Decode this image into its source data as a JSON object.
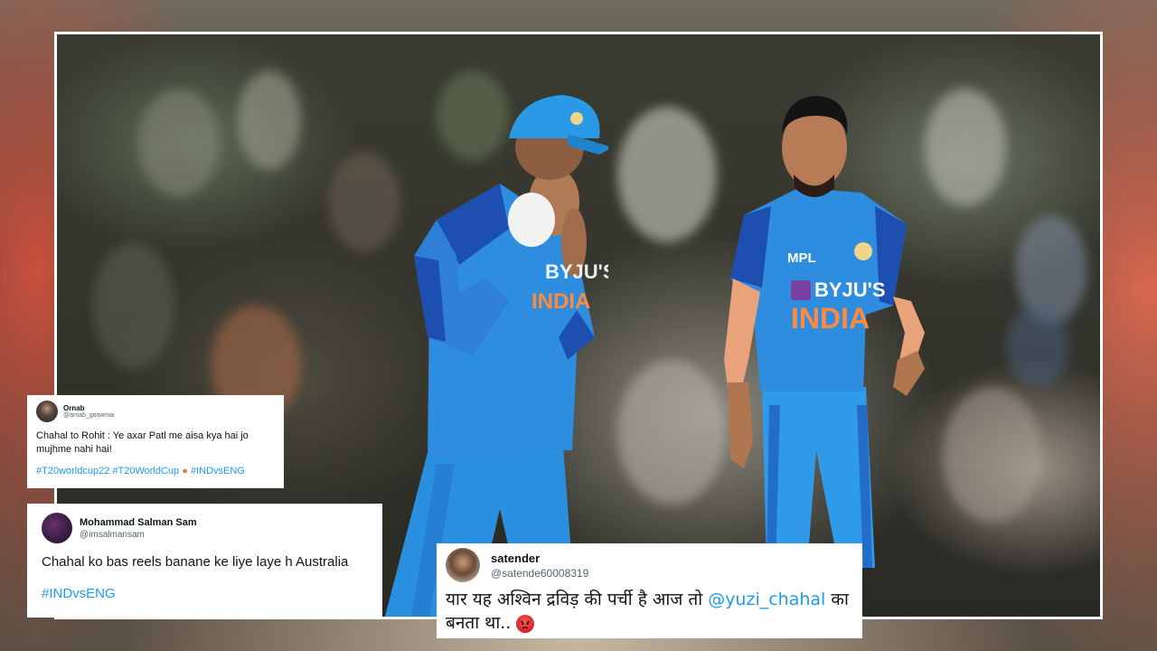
{
  "tweets": [
    {
      "name": "Ornab",
      "handle": "@arnab_goswmai",
      "text": "Chahal to Rohit : Ye axar Patl me aisa kya hai jo mujhme nahi hai!",
      "hashtags": "#T20worldcup22 #T20WorldCup",
      "hashtags_after_emoji": "#INDvsENG"
    },
    {
      "name": "Mohammad Salman Sam",
      "handle": "@imsalmansam",
      "text": "Chahal ko bas reels banane ke liye laye h Australia",
      "hashtags": "#INDvsENG"
    },
    {
      "name": "satender",
      "handle": "@satende60008319",
      "text_before_mention": "यार यह अश्विन द्रविड़ की पर्ची है आज तो ",
      "mention": "@yuzi_chahal",
      "text_after_mention": " का बनता था..",
      "emoji": "angry-face-icon"
    }
  ],
  "jersey": {
    "sponsor": "BYJU'S",
    "team": "INDIA",
    "logo": "MPL"
  },
  "colors": {
    "jersey_blue": "#2f8de0",
    "jersey_dark": "#1d4fb0",
    "cap_blue": "#2a9ae6",
    "jersey_orange": "#ff8a3d",
    "link_blue": "#1d9bf0"
  }
}
